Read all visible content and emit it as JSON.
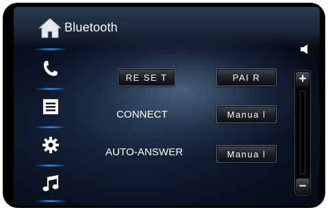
{
  "header": {
    "title": "Bluetooth",
    "home_icon": "home-icon"
  },
  "sidebar": {
    "items": [
      {
        "name": "phone",
        "icon": "phone-icon"
      },
      {
        "name": "list",
        "icon": "list-icon"
      },
      {
        "name": "settings",
        "icon": "gear-icon"
      },
      {
        "name": "music",
        "icon": "music-note-icon"
      }
    ]
  },
  "main": {
    "reset_label": "RE SE T",
    "pair_label": "PAI R",
    "connect": {
      "label": "CONNECT",
      "value": "Manua l"
    },
    "auto_answer": {
      "label": "AUTO-ANSWER",
      "value": "Manua l"
    }
  },
  "volume": {
    "plus_label": "+",
    "minus_label": "–",
    "level": 0
  },
  "colors": {
    "accent": "#4fa8ff",
    "background": "#0c1628"
  }
}
